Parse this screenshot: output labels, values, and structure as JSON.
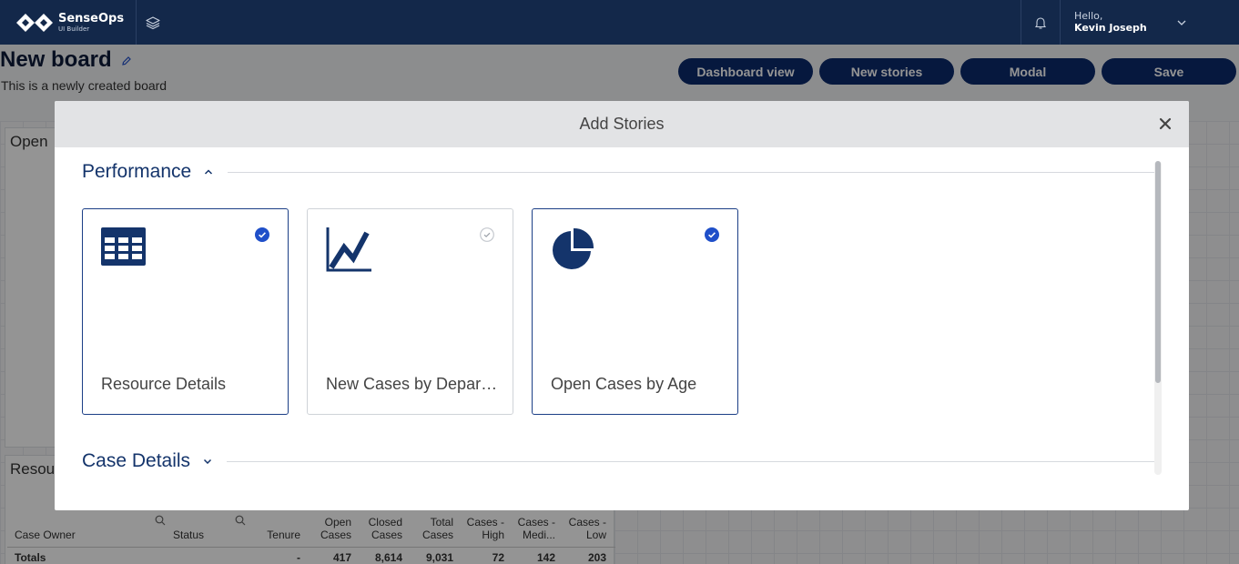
{
  "app": {
    "name": "SenseOps",
    "subtitle": "UI Builder"
  },
  "user": {
    "greeting": "Hello,",
    "name": "Kevin Joseph"
  },
  "page": {
    "title": "New board",
    "description": "This is a newly created board"
  },
  "toolbar": {
    "buttons": [
      {
        "label": "Dashboard view"
      },
      {
        "label": "New stories"
      },
      {
        "label": "Modal"
      },
      {
        "label": "Save"
      }
    ]
  },
  "background": {
    "panel1_title": "Open",
    "panel2_title": "Resou",
    "table": {
      "headers": [
        "Case Owner",
        "Status",
        "Tenure",
        "Open Cases",
        "Closed Cases",
        "Total Cases",
        "Cases - High",
        "Cases - Medi...",
        "Cases - Low"
      ],
      "totals": [
        "Totals",
        "",
        "-",
        "417",
        "8,614",
        "9,031",
        "72",
        "142",
        "203"
      ]
    }
  },
  "modal": {
    "title": "Add Stories",
    "sections": [
      {
        "title": "Performance",
        "expanded": true,
        "cards": [
          {
            "label": "Resource Details",
            "icon": "table-icon",
            "selected": true
          },
          {
            "label": "New Cases by Department",
            "icon": "line-chart-icon",
            "selected": false
          },
          {
            "label": "Open Cases by Age",
            "icon": "pie-chart-icon",
            "selected": true
          }
        ]
      },
      {
        "title": "Case Details",
        "expanded": false
      }
    ]
  },
  "colors": {
    "navy": "#13284a",
    "button": "#0c2a6c",
    "accent": "#1f4fc9",
    "icon": "#14346b"
  }
}
